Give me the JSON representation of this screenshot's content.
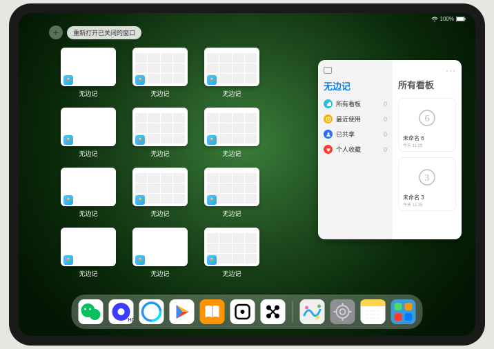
{
  "status": {
    "signal": "wifi",
    "battery": "100%"
  },
  "toolbar": {
    "plus": "+",
    "reopen_label": "重新打开已关闭的窗口"
  },
  "app_name": "无边记",
  "windows": [
    {
      "type": "blank",
      "label": "无边记"
    },
    {
      "type": "grid",
      "label": "无边记"
    },
    {
      "type": "grid",
      "label": "无边记"
    },
    {
      "type": "blank",
      "label": "无边记"
    },
    {
      "type": "grid",
      "label": "无边记"
    },
    {
      "type": "grid",
      "label": "无边记"
    },
    {
      "type": "blank",
      "label": "无边记"
    },
    {
      "type": "grid",
      "label": "无边记"
    },
    {
      "type": "grid",
      "label": "无边记"
    },
    {
      "type": "blank",
      "label": "无边记"
    },
    {
      "type": "blank",
      "label": "无边记"
    },
    {
      "type": "grid",
      "label": "无边记"
    }
  ],
  "sidebar": {
    "title": "无边记",
    "items": [
      {
        "icon": "cloud",
        "color": "#2ac1d6",
        "label": "所有看板",
        "count": 0
      },
      {
        "icon": "clock",
        "color": "#f7b500",
        "label": "最近使用",
        "count": 0
      },
      {
        "icon": "person",
        "color": "#2b6df6",
        "label": "已共享",
        "count": 0
      },
      {
        "icon": "heart",
        "color": "#ff3b30",
        "label": "个人收藏",
        "count": 0
      }
    ],
    "right_title": "所有看板",
    "boards": [
      {
        "name": "未命名 6",
        "date": "今天 11:25",
        "digit": "6"
      },
      {
        "name": "未命名 3",
        "date": "今天 11:25",
        "digit": "3"
      }
    ]
  },
  "dock": [
    {
      "name": "wechat",
      "bg": "#ffffff"
    },
    {
      "name": "quark",
      "bg": "#ffffff"
    },
    {
      "name": "qqbrowser",
      "bg": "#ffffff"
    },
    {
      "name": "play",
      "bg": "#ffffff"
    },
    {
      "name": "books",
      "bg": "#ff9500"
    },
    {
      "name": "dice",
      "bg": "#ffffff"
    },
    {
      "name": "dots",
      "bg": "#ffffff"
    },
    {
      "name": "freeform",
      "bg": "#ffffff"
    },
    {
      "name": "settings",
      "bg": "#808080"
    },
    {
      "name": "notes",
      "bg": "#ffffff"
    },
    {
      "name": "apps",
      "bg": "#4aa8d8"
    }
  ]
}
